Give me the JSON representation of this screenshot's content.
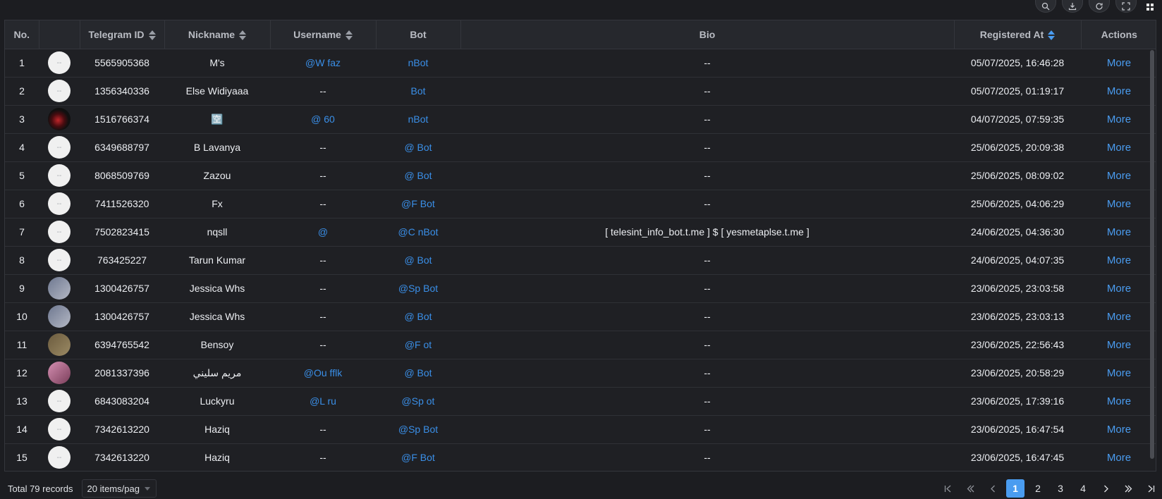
{
  "toolbar": {
    "icons": [
      "search-icon",
      "download-icon",
      "refresh-icon",
      "fullscreen-icon",
      "grid-icon"
    ]
  },
  "table": {
    "headers": {
      "no": "No.",
      "avatar": "",
      "telegram_id": "Telegram ID",
      "nickname": "Nickname",
      "username": "Username",
      "bot": "Bot",
      "bio": "Bio",
      "registered_at": "Registered At",
      "actions": "Actions"
    },
    "rows": [
      {
        "no": "1",
        "avatar": "--",
        "telegram_id": "5565905368",
        "nickname": "M's",
        "username": "@W    faz",
        "bot": "       nBot",
        "bio": "--",
        "registered_at": "05/07/2025, 16:46:28",
        "action": "More"
      },
      {
        "no": "2",
        "avatar": "--",
        "telegram_id": "1356340336",
        "nickname": "Else Widiyaaa",
        "username": "--",
        "bot": "      Bot",
        "bio": "--",
        "registered_at": "05/07/2025, 01:19:17",
        "action": "More"
      },
      {
        "no": "3",
        "avatar": "",
        "telegram_id": "1516766374",
        "nickname": "🈳",
        "username": "@    60",
        "bot": "       nBot",
        "bio": "--",
        "registered_at": "04/07/2025, 07:59:35",
        "action": "More"
      },
      {
        "no": "4",
        "avatar": "--",
        "telegram_id": "6349688797",
        "nickname": "B Lavanya",
        "username": "--",
        "bot": "@     Bot",
        "bio": "--",
        "registered_at": "25/06/2025, 20:09:38",
        "action": "More"
      },
      {
        "no": "5",
        "avatar": "--",
        "telegram_id": "8068509769",
        "nickname": "Zazou",
        "username": "--",
        "bot": "@     Bot",
        "bio": "--",
        "registered_at": "25/06/2025, 08:09:02",
        "action": "More"
      },
      {
        "no": "6",
        "avatar": "--",
        "telegram_id": "7411526320",
        "nickname": "Fx",
        "username": "--",
        "bot": "@F    Bot",
        "bio": "--",
        "registered_at": "25/06/2025, 04:06:29",
        "action": "More"
      },
      {
        "no": "7",
        "avatar": "--",
        "telegram_id": "7502823415",
        "nickname": "nqsll",
        "username": "@",
        "bot": "@C     nBot",
        "bio": "[ telesint_info_bot.t.me ] $ [ yesmetaplse.t.me ]",
        "registered_at": "24/06/2025, 04:36:30",
        "action": "More"
      },
      {
        "no": "8",
        "avatar": "--",
        "telegram_id": "763425227",
        "nickname": "Tarun Kumar",
        "username": "--",
        "bot": "@     Bot",
        "bio": "--",
        "registered_at": "24/06/2025, 04:07:35",
        "action": "More"
      },
      {
        "no": "9",
        "avatar": "",
        "telegram_id": "1300426757",
        "nickname": "Jessica Whs",
        "username": "--",
        "bot": "@Sp    Bot",
        "bio": "--",
        "registered_at": "23/06/2025, 23:03:58",
        "action": "More"
      },
      {
        "no": "10",
        "avatar": "",
        "telegram_id": "1300426757",
        "nickname": "Jessica Whs",
        "username": "--",
        "bot": "@     Bot",
        "bio": "--",
        "registered_at": "23/06/2025, 23:03:13",
        "action": "More"
      },
      {
        "no": "11",
        "avatar": "",
        "telegram_id": "6394765542",
        "nickname": "Bensoy",
        "username": "--",
        "bot": "@F    ot",
        "bio": "--",
        "registered_at": "23/06/2025, 22:56:43",
        "action": "More"
      },
      {
        "no": "12",
        "avatar": "",
        "telegram_id": "2081337396",
        "nickname": "مريم سليني",
        "username": "@Ou     fflk",
        "bot": "@     Bot",
        "bio": "--",
        "registered_at": "23/06/2025, 20:58:29",
        "action": "More"
      },
      {
        "no": "13",
        "avatar": "--",
        "telegram_id": "6843083204",
        "nickname": "Luckyru",
        "username": "@L     ru",
        "bot": "@Sp     ot",
        "bio": "--",
        "registered_at": "23/06/2025, 17:39:16",
        "action": "More"
      },
      {
        "no": "14",
        "avatar": "--",
        "telegram_id": "7342613220",
        "nickname": "Haziq",
        "username": "--",
        "bot": "@Sp    Bot",
        "bio": "--",
        "registered_at": "23/06/2025, 16:47:54",
        "action": "More"
      },
      {
        "no": "15",
        "avatar": "--",
        "telegram_id": "7342613220",
        "nickname": "Haziq",
        "username": "--",
        "bot": "@F    Bot",
        "bio": "--",
        "registered_at": "23/06/2025, 16:47:45",
        "action": "More"
      }
    ]
  },
  "footer": {
    "total": "Total 79 records",
    "page_size": "20 items/pag",
    "pages": [
      "1",
      "2",
      "3",
      "4"
    ],
    "current_page": "1"
  },
  "colors": {
    "accent": "#4a9cf0",
    "link": "#3a8fe8",
    "background": "#1c1d21"
  }
}
